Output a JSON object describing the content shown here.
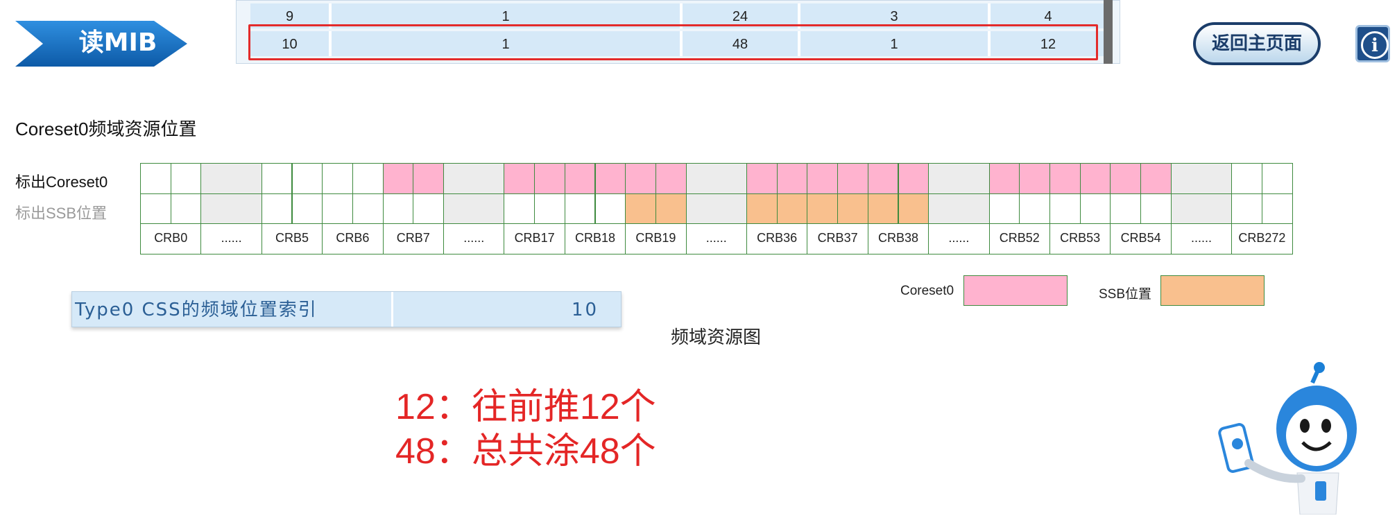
{
  "header": {
    "badge_label": "读MIB",
    "home_button": "返回主页面",
    "info_button": "i"
  },
  "table": {
    "rows": [
      [
        "9",
        "1",
        "24",
        "3",
        "4"
      ],
      [
        "10",
        "1",
        "48",
        "1",
        "12"
      ]
    ],
    "highlighted_row": 1
  },
  "section_title": "Coreset0频域资源位置",
  "grid": {
    "row_labels": [
      "标出Coreset0",
      "标出SSB位置"
    ],
    "columns": [
      {
        "label": "CRB0",
        "span": 2,
        "coreset": [
          false,
          false
        ],
        "ssb": [
          false,
          false
        ]
      },
      {
        "label": "......",
        "span": 2,
        "gap": true
      },
      {
        "label": "CRB5",
        "span": 2,
        "coreset": [
          false,
          false
        ],
        "ssb": [
          false,
          false
        ]
      },
      {
        "label": "CRB6",
        "span": 2,
        "coreset": [
          false,
          false
        ],
        "ssb": [
          false,
          false
        ]
      },
      {
        "label": "CRB7",
        "span": 2,
        "coreset": [
          true,
          true
        ],
        "ssb": [
          false,
          false
        ]
      },
      {
        "label": "......",
        "span": 2,
        "gap": true
      },
      {
        "label": "CRB17",
        "span": 2,
        "coreset": [
          true,
          true
        ],
        "ssb": [
          false,
          false
        ]
      },
      {
        "label": "CRB18",
        "span": 2,
        "coreset": [
          true,
          true
        ],
        "ssb": [
          false,
          false
        ]
      },
      {
        "label": "CRB19",
        "span": 2,
        "coreset": [
          true,
          true
        ],
        "ssb": [
          true,
          true
        ]
      },
      {
        "label": "......",
        "span": 2,
        "gap": true
      },
      {
        "label": "CRB36",
        "span": 2,
        "coreset": [
          true,
          true
        ],
        "ssb": [
          true,
          true
        ]
      },
      {
        "label": "CRB37",
        "span": 2,
        "coreset": [
          true,
          true
        ],
        "ssb": [
          true,
          true
        ]
      },
      {
        "label": "CRB38",
        "span": 2,
        "coreset": [
          true,
          true
        ],
        "ssb": [
          true,
          true
        ]
      },
      {
        "label": "......",
        "span": 2,
        "gap": true
      },
      {
        "label": "CRB52",
        "span": 2,
        "coreset": [
          true,
          true
        ],
        "ssb": [
          false,
          false
        ]
      },
      {
        "label": "CRB53",
        "span": 2,
        "coreset": [
          true,
          true
        ],
        "ssb": [
          false,
          false
        ]
      },
      {
        "label": "CRB54",
        "span": 2,
        "coreset": [
          true,
          true
        ],
        "ssb": [
          false,
          false
        ]
      },
      {
        "label": "......",
        "span": 2,
        "gap": true
      },
      {
        "label": "CRB272",
        "span": 2,
        "coreset": [
          false,
          false
        ],
        "ssb": [
          false,
          false
        ]
      }
    ]
  },
  "legend": [
    {
      "label": "Coreset0",
      "color": "#ffb3cf"
    },
    {
      "label": "SSB位置",
      "color": "#f9c08e"
    }
  ],
  "type0": {
    "label": "Type0 CSS的频域位置索引",
    "value": "10"
  },
  "caption": "频域资源图",
  "notes": [
    "12：往前推12个",
    "48：总共涂48个"
  ],
  "colors": {
    "accent_blue": "#1a6fc0",
    "highlight_red": "#e32b2b",
    "note_red": "#e42626"
  }
}
